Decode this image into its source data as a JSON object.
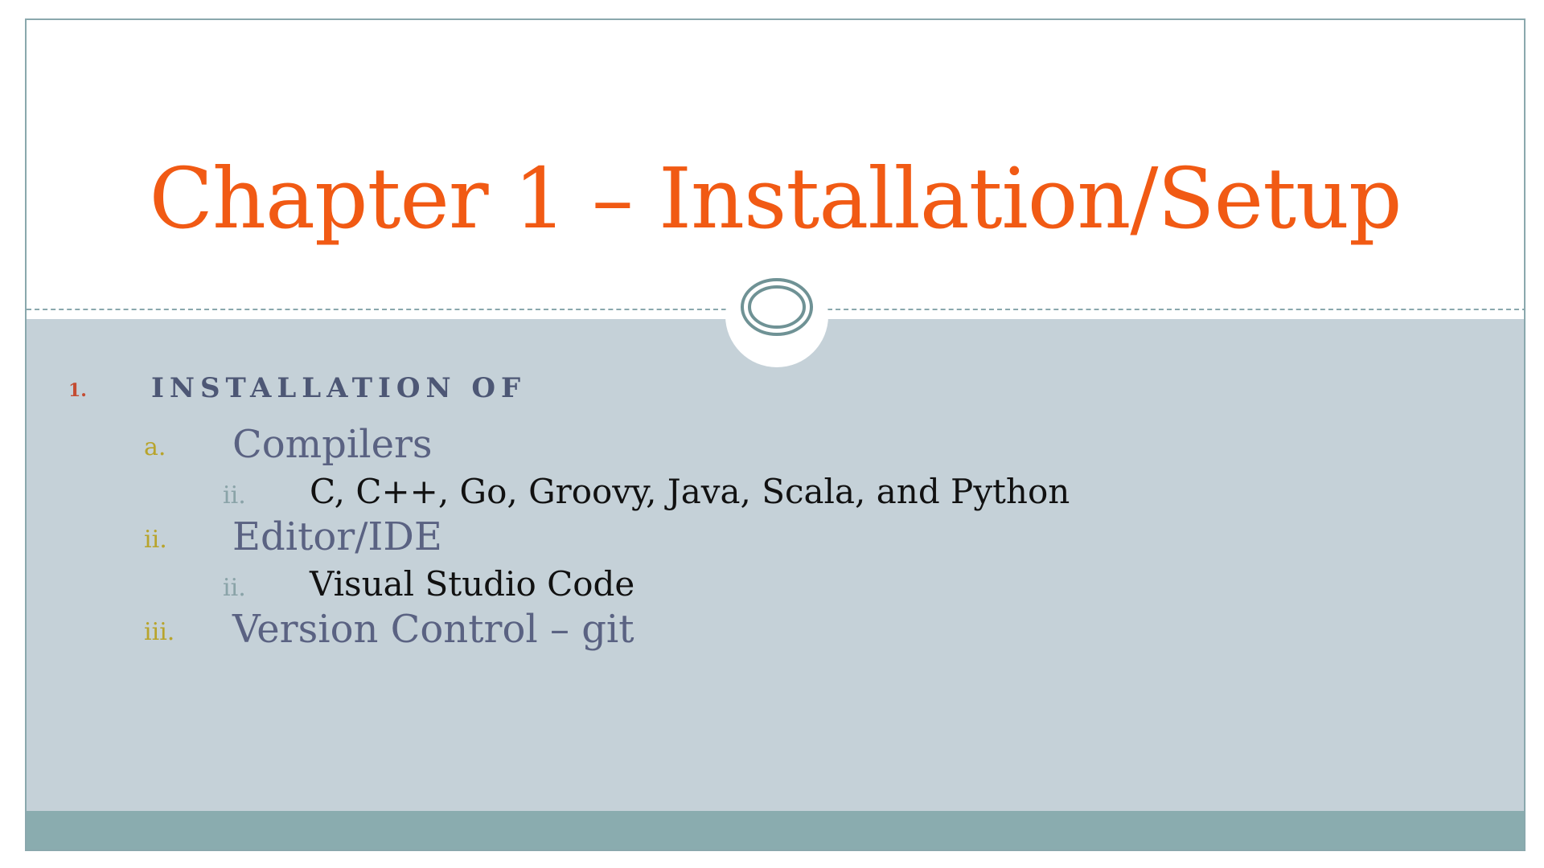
{
  "slide": {
    "title": "Chapter 1 – Installation/Setup",
    "colors": {
      "title": "#f15a14",
      "content_background": "#c5d1d8",
      "footer_bar": "#8aacaf",
      "border": "#8aa8ad"
    },
    "ornament_icon": "double-ring-ornament",
    "outline": {
      "item1_marker": "1.",
      "item1_text": "INSTALLATION OF",
      "compilers_marker": "a.",
      "compilers_text": "Compilers",
      "compilers_sub_marker": "ii.",
      "compilers_sub_text": "C, C++, Go, Groovy, Java, Scala, and Python",
      "editor_marker": "ii.",
      "editor_text": "Editor/IDE",
      "editor_sub_marker": "ii.",
      "editor_sub_text": "Visual Studio Code",
      "vc_marker": "iii.",
      "vc_text": "Version Control – git"
    }
  }
}
